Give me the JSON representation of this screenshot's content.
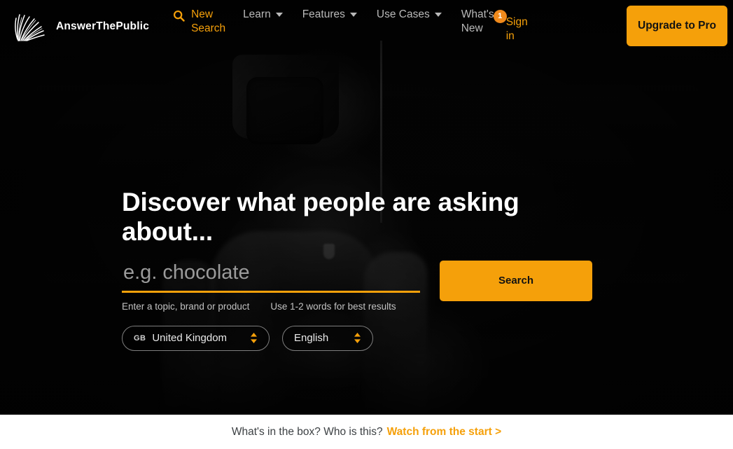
{
  "brand": {
    "name": "AnswerThePublic",
    "logo_icon": "seed-head-burst-icon"
  },
  "nav": {
    "new_search": {
      "label": "New Search",
      "icon": "search-icon"
    },
    "items": [
      {
        "label": "Learn",
        "has_caret": true
      },
      {
        "label": "Features",
        "has_caret": true
      },
      {
        "label": "Use Cases",
        "has_caret": true
      },
      {
        "label": "What's New",
        "has_caret": false
      }
    ],
    "sign_in": {
      "label": "Sign in",
      "badge_count": "1"
    },
    "upgrade": {
      "label": "Upgrade to Pro"
    }
  },
  "hero": {
    "headline": "Discover what people are asking about...",
    "search": {
      "value": "",
      "placeholder": "e.g. chocolate",
      "button_label": "Search"
    },
    "hints": {
      "hint_1": "Enter a topic, brand or product",
      "hint_2": "Use 1-2 words for best results"
    },
    "country_select": {
      "code": "GB",
      "label": "United Kingdom",
      "icon": "stepper-updown-icon"
    },
    "language_select": {
      "label": "English",
      "icon": "stepper-updown-icon"
    }
  },
  "bottom_bar": {
    "text": "What's in the box? Who is this?",
    "link_label": "Watch from the start >"
  },
  "colors": {
    "accent_orange": "#f5a00a",
    "badge_orange": "#f08a1c",
    "hero_background": "#050505",
    "bottom_bar_background": "#ffffff",
    "bottom_bar_text": "#3c4043",
    "nav_link": "#b9b9b9"
  }
}
